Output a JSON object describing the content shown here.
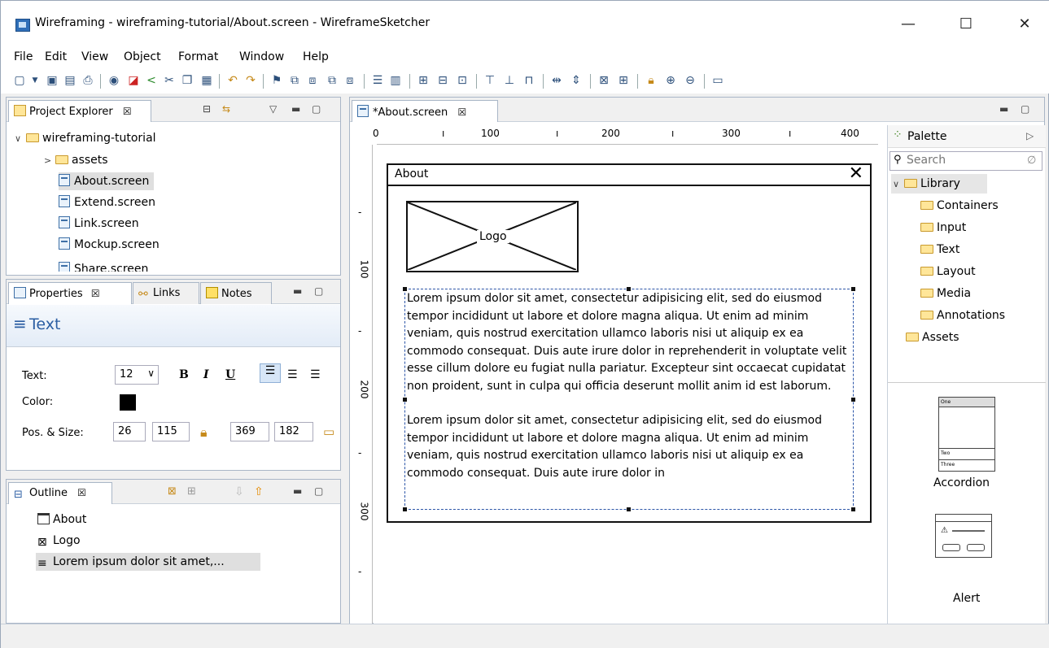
{
  "window": {
    "title": "Wireframing - wireframing-tutorial/About.screen - WireframeSketcher",
    "minimize": "—",
    "maximize": "☐",
    "close": "✕"
  },
  "menu": [
    "File",
    "Edit",
    "View",
    "Object",
    "Format",
    "Window",
    "Help"
  ],
  "project_explorer": {
    "tab": "Project Explorer",
    "tab_close": "☒",
    "tree": [
      {
        "label": "wireframing-tutorial"
      },
      {
        "label": "assets"
      },
      {
        "label": "About.screen"
      },
      {
        "label": "Extend.screen"
      },
      {
        "label": "Link.screen"
      },
      {
        "label": "Mockup.screen"
      },
      {
        "label": "Share.screen"
      }
    ]
  },
  "properties": {
    "tabs": [
      "Properties",
      "Links",
      "Notes"
    ],
    "tab_close": "☒",
    "section_title": "Text",
    "text_label": "Text:",
    "font_size": "12",
    "bold": "B",
    "italic": "I",
    "underline": "U",
    "color_label": "Color:",
    "color_value": "#000000",
    "pos_size_label": "Pos. & Size:",
    "x": "26",
    "y": "115",
    "width": "369",
    "height": "182"
  },
  "outline": {
    "tab": "Outline",
    "tab_close": "☒",
    "items": [
      "About",
      "Logo",
      "Lorem ipsum dolor sit amet,..."
    ]
  },
  "editor": {
    "tab": "*About.screen",
    "tab_close": "☒",
    "ruler_h": [
      "0",
      "100",
      "200",
      "300",
      "400"
    ],
    "ruler_v": [
      "100",
      "200",
      "300"
    ],
    "window_title": "About",
    "window_close": "✕",
    "logo_label": "Logo",
    "paragraph1": "Lorem ipsum dolor sit amet, consectetur adipisicing elit, sed do eiusmod tempor incididunt ut labore et dolore magna aliqua. Ut enim ad minim veniam, quis nostrud exercitation ullamco laboris nisi ut aliquip ex ea commodo consequat. Duis aute irure dolor in reprehenderit in voluptate velit esse cillum dolore eu fugiat nulla pariatur. Excepteur sint occaecat cupidatat non proident, sunt in culpa qui officia deserunt mollit anim id est laborum.",
    "paragraph2": "Lorem ipsum dolor sit amet, consectetur adipisicing elit, sed do eiusmod tempor incididunt ut labore et dolore magna aliqua. Ut enim ad minim veniam, quis nostrud exercitation ullamco laboris nisi ut aliquip ex ea commodo consequat. Duis aute irure dolor in"
  },
  "palette": {
    "title": "Palette",
    "search_placeholder": "Search",
    "library": "Library",
    "categories": [
      "Containers",
      "Input",
      "Text",
      "Layout",
      "Media",
      "Annotations"
    ],
    "assets": "Assets",
    "widgets": [
      {
        "label": "Accordion",
        "rows": [
          "One",
          "Two",
          "Three"
        ]
      },
      {
        "label": "Alert"
      }
    ]
  }
}
